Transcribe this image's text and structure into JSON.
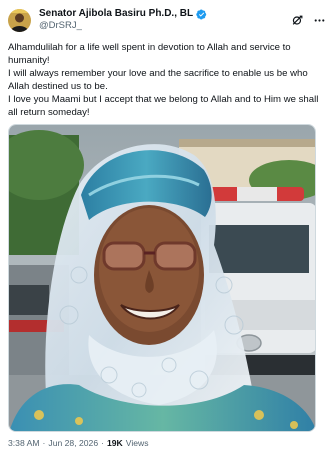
{
  "author": {
    "display_name": "Senator Ajibola Basiru Ph.D., BL",
    "handle": "@DrSRJ_",
    "verified": true
  },
  "post": {
    "lines": [
      "Alhamdulilah for a life well spent in devotion to Allah and service to humanity!",
      "I will always remember your love and the sacrifice to enable us be who Allah destined us to be.",
      "I love you Maami but I accept that we belong to Allah and to Him we shall all return someday!"
    ]
  },
  "meta": {
    "time": "3:38 AM",
    "separator1": "·",
    "date": "Jun 28, 2026",
    "separator2": "·",
    "views_count": "19K",
    "views_label": "Views"
  },
  "icons": {
    "verified": "verified-badge-icon",
    "grok": "grok-icon",
    "more": "more-horizontal-icon"
  },
  "colors": {
    "verified_blue": "#1d9bf0",
    "text": "#0f1419",
    "secondary_text": "#536471",
    "border": "#cfd9de"
  }
}
